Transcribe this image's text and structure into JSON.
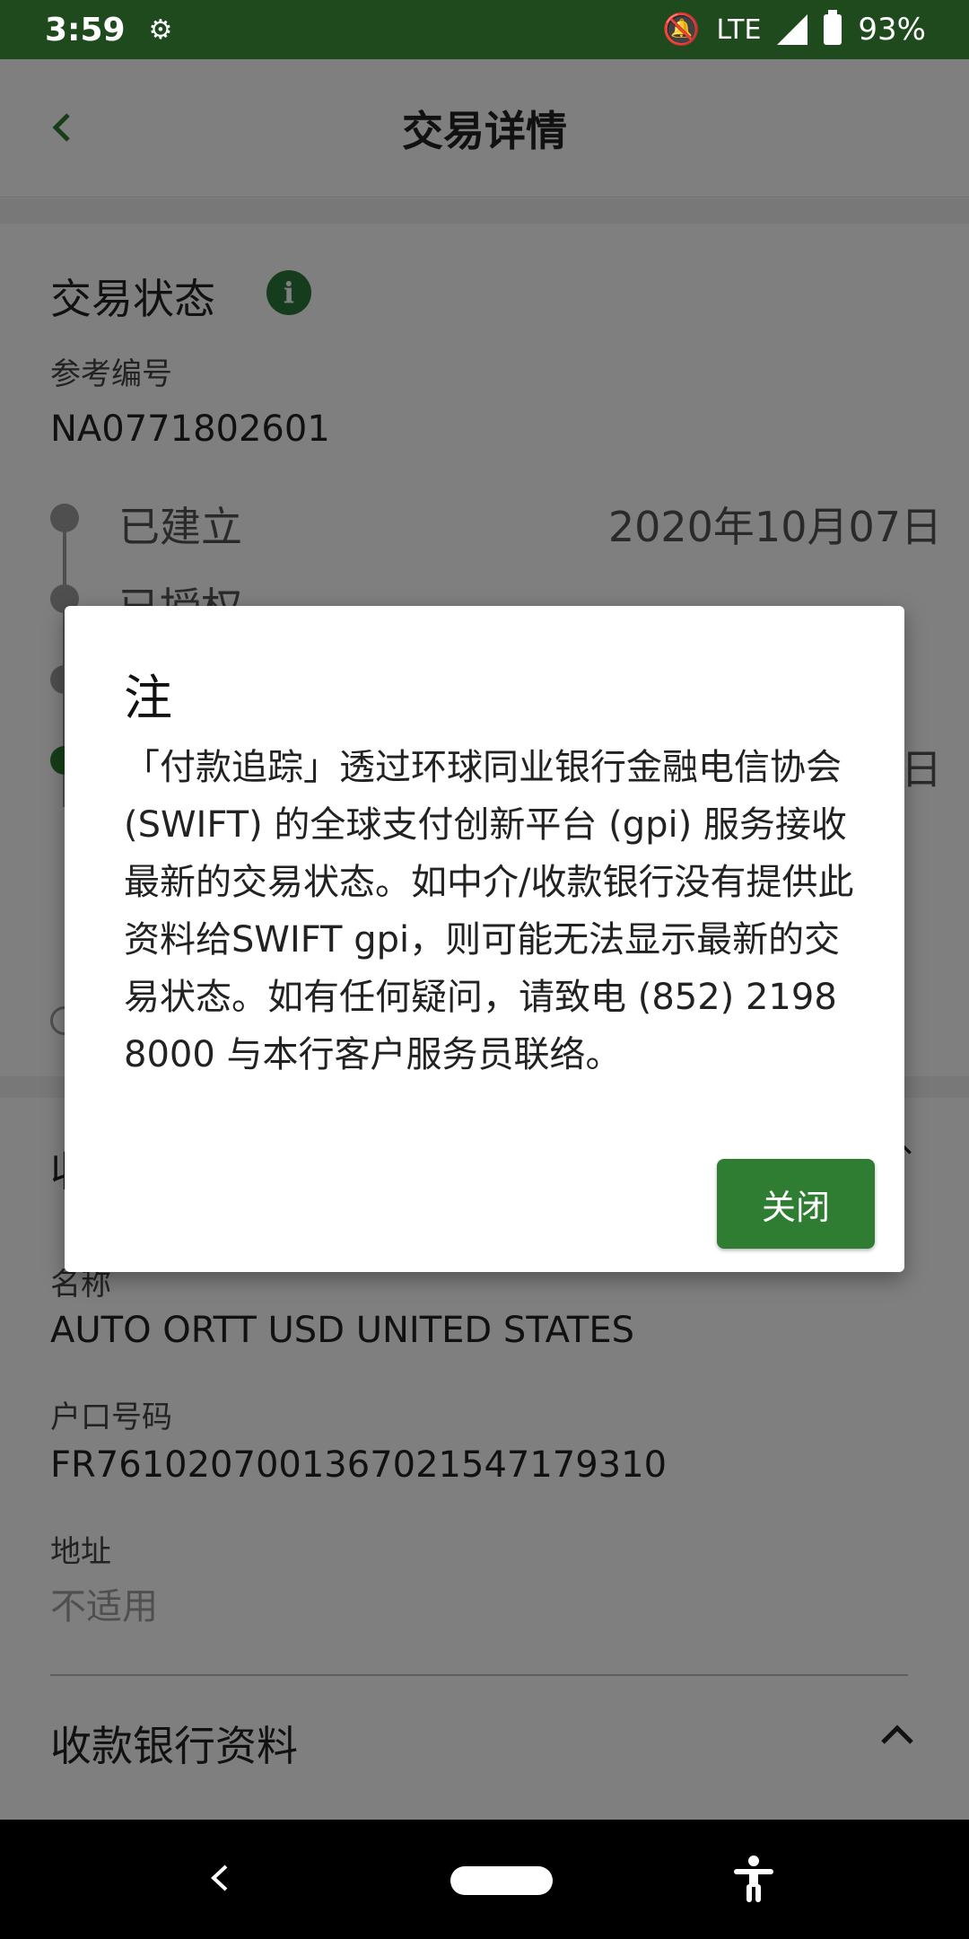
{
  "status_bar": {
    "time": "3:59",
    "network": "LTE",
    "battery": "93%"
  },
  "app_bar": {
    "title": "交易详情"
  },
  "transaction_status": {
    "section_title": "交易状态",
    "ref_label": "参考编号",
    "ref_value": "NA0771802601",
    "timeline": [
      {
        "label": "已建立",
        "date": "2020年10月07日"
      },
      {
        "label": "已授权",
        "date": ""
      },
      {
        "label": "",
        "date": ""
      },
      {
        "label": "",
        "date": "日"
      }
    ]
  },
  "beneficiary": {
    "section_title_partial": "收",
    "name_label": "名称",
    "name_value": "AUTO ORTT USD UNITED STATES",
    "account_label": "户口号码",
    "account_value": "FR7610207001367021547179310",
    "address_label": "地址",
    "address_value": "不适用"
  },
  "beneficiary_bank": {
    "section_title": "收款银行资料"
  },
  "dialog": {
    "title": "注",
    "body": "「付款追踪」透过环球同业银行金融电信协会 (SWIFT) 的全球支付创新平台 (gpi) 服务接收最新的交易状态。如中介/收款银行没有提供此资料给SWIFT gpi，则可能无法显示最新的交易状态。如有任何疑问，请致电 (852) 2198 8000 与本行客户服务员联络。",
    "close_label": "关闭"
  },
  "colors": {
    "status_bar_bg": "#1e4a1e",
    "brand_green": "#2e7d32",
    "info_icon": "#2a7a3a"
  },
  "icons": [
    "back-arrow-icon",
    "info-icon",
    "chevron-up-icon",
    "nav-back-icon",
    "nav-home-icon",
    "accessibility-icon",
    "signal-icon",
    "battery-icon",
    "bell-off-icon",
    "settings-gear-icon"
  ]
}
